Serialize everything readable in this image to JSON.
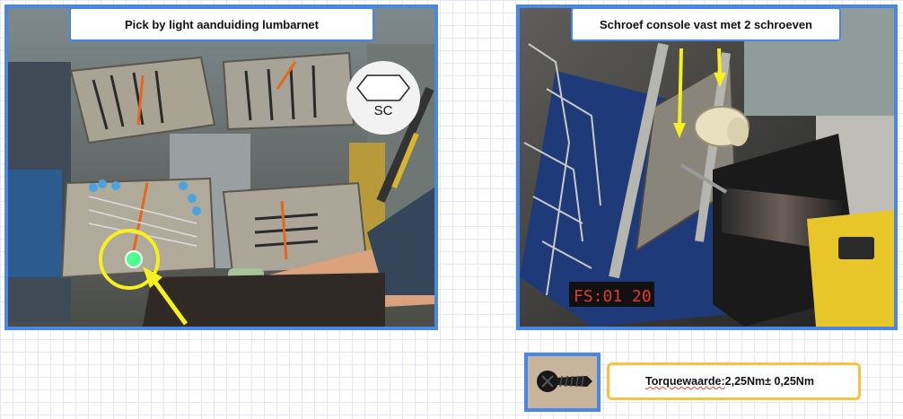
{
  "left_panel": {
    "caption": "Pick by light aanduiding lumbarnet",
    "badge_label": "SC",
    "badge_icon": "hexagon-icon"
  },
  "right_panel": {
    "caption": "Schroef console vast met 2 schroeven",
    "timestamp_overlay": "FS:01 20"
  },
  "screw_thumbnail": {
    "icon": "screw-icon"
  },
  "torque": {
    "label": "Torquewaarde:",
    "value": "2,25Nm± 0,25Nm"
  },
  "colors": {
    "frame_blue": "#4a86e8",
    "arrow_yellow": "#f5f01e",
    "torque_border": "#f5c242"
  }
}
